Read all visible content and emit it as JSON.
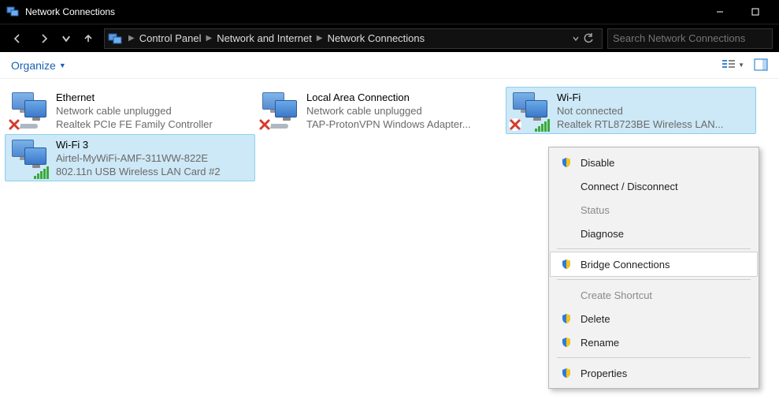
{
  "titlebar": {
    "title": "Network Connections"
  },
  "nav": {
    "breadcrumb": [
      "Control Panel",
      "Network and Internet",
      "Network Connections"
    ],
    "search_placeholder": "Search Network Connections"
  },
  "toolbar": {
    "organize": "Organize"
  },
  "adapters": [
    {
      "name": "Ethernet",
      "status": "Network cable unplugged",
      "device": "Realtek PCIe FE Family Controller",
      "selected": false,
      "overlay": "cross-cable"
    },
    {
      "name": "Local Area Connection",
      "status": "Network cable unplugged",
      "device": "TAP-ProtonVPN Windows Adapter...",
      "selected": false,
      "overlay": "cross-cable"
    },
    {
      "name": "Wi-Fi",
      "status": "Not connected",
      "device": "Realtek RTL8723BE Wireless LAN...",
      "selected": true,
      "overlay": "cross-signal"
    },
    {
      "name": "Wi-Fi 3",
      "status": "Airtel-MyWiFi-AMF-311WW-822E",
      "device": "802.11n USB Wireless LAN Card #2",
      "selected": true,
      "overlay": "signal"
    }
  ],
  "context_menu": {
    "items": [
      {
        "label": "Disable",
        "shield": true,
        "enabled": true
      },
      {
        "label": "Connect / Disconnect",
        "shield": false,
        "enabled": true
      },
      {
        "label": "Status",
        "shield": false,
        "enabled": false
      },
      {
        "label": "Diagnose",
        "shield": false,
        "enabled": true
      },
      {
        "sep": true
      },
      {
        "label": "Bridge Connections",
        "shield": true,
        "enabled": true,
        "hover": true
      },
      {
        "sep": true
      },
      {
        "label": "Create Shortcut",
        "shield": false,
        "enabled": false
      },
      {
        "label": "Delete",
        "shield": true,
        "enabled": true
      },
      {
        "label": "Rename",
        "shield": true,
        "enabled": true
      },
      {
        "sep": true
      },
      {
        "label": "Properties",
        "shield": true,
        "enabled": true
      }
    ]
  }
}
